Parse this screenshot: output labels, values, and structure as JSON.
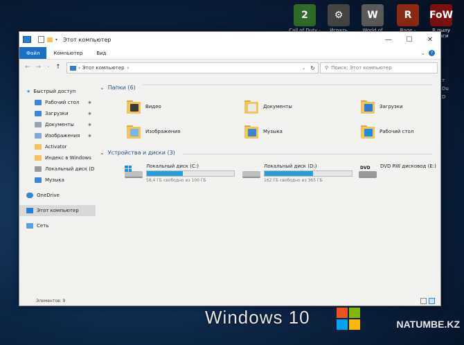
{
  "desktop": {
    "icons": [
      {
        "label": "Call of Duty -",
        "icon": "cod-icon",
        "color": "#2f6b2a",
        "glyph": "2"
      },
      {
        "label": "Играть",
        "icon": "play-gear-icon",
        "color": "#444444",
        "glyph": "⚙"
      },
      {
        "label": "World of",
        "icon": "wot-icon",
        "color": "#5a5a5a",
        "glyph": "W"
      },
      {
        "label": "Rage -",
        "icon": "rage-icon",
        "color": "#8a2a14",
        "glyph": "R"
      },
      {
        "label": "В пылу враги",
        "icon": "fow-icon",
        "color": "#7a1010",
        "glyph": "FoW"
      }
    ],
    "right_edge": [
      "т",
      "Du",
      "D"
    ],
    "brand_text": "Windows 10",
    "watermark": "NATUMBE.KZ"
  },
  "window": {
    "title": "Этот компьютер",
    "controls": {
      "minimize": "—",
      "maximize": "☐",
      "close": "✕"
    },
    "ribbon_tabs": [
      "Файл",
      "Компьютер",
      "Вид"
    ],
    "help_glyph": "?",
    "address": {
      "path_label": "Этот компьютер",
      "separator": "›"
    },
    "search_placeholder": "Поиск: Этот компьютер",
    "sidebar": {
      "quick_access": "Быстрый доступ",
      "items": [
        {
          "label": "Рабочий стол",
          "color": "#3b86d4",
          "pinned": true
        },
        {
          "label": "Загрузки",
          "color": "#3b86d4",
          "pinned": true
        },
        {
          "label": "Документы",
          "color": "#9aa3ad",
          "pinned": true
        },
        {
          "label": "Изображения",
          "color": "#7fa9d6",
          "pinned": true
        },
        {
          "label": "Activator",
          "color": "#f3c45a",
          "pinned": false
        },
        {
          "label": "Индекс в Windows",
          "color": "#f3c45a",
          "pinned": false
        },
        {
          "label": "Локальный диск (D",
          "color": "#9a9a9a",
          "pinned": false
        },
        {
          "label": "Музыка",
          "color": "#3b86d4",
          "pinned": false
        }
      ],
      "onedrive": "OneDrive",
      "this_pc": "Этот компьютер",
      "network": "Сеть",
      "pin_glyph": "✱"
    },
    "folders_header": "Папки (6)",
    "folders": [
      {
        "label": "Видео",
        "overlay": "#3a3a3a"
      },
      {
        "label": "Документы",
        "overlay": "#e9e9e9"
      },
      {
        "label": "Загрузки",
        "overlay": "#2a7fd4"
      },
      {
        "label": "Изображения",
        "overlay": "#7fb3e0"
      },
      {
        "label": "Музыка",
        "overlay": "#3b86d4"
      },
      {
        "label": "Рабочий стол",
        "overlay": "#1e8ee0"
      }
    ],
    "drives_header": "Устройства и диски (3)",
    "drives": [
      {
        "label": "Локальный диск (C:)",
        "free": "58,4 ГБ свободно из 100 ГБ",
        "used_fraction": 0.416,
        "windows_logo": true
      },
      {
        "label": "Локальный диск (D:)",
        "free": "162 ГБ свободно из 365 ГБ",
        "used_fraction": 0.556,
        "windows_logo": false
      },
      {
        "label": "DVD RW дисковод (E:)",
        "dvd_text": "DVD"
      }
    ],
    "status": "Элементов: 9"
  }
}
